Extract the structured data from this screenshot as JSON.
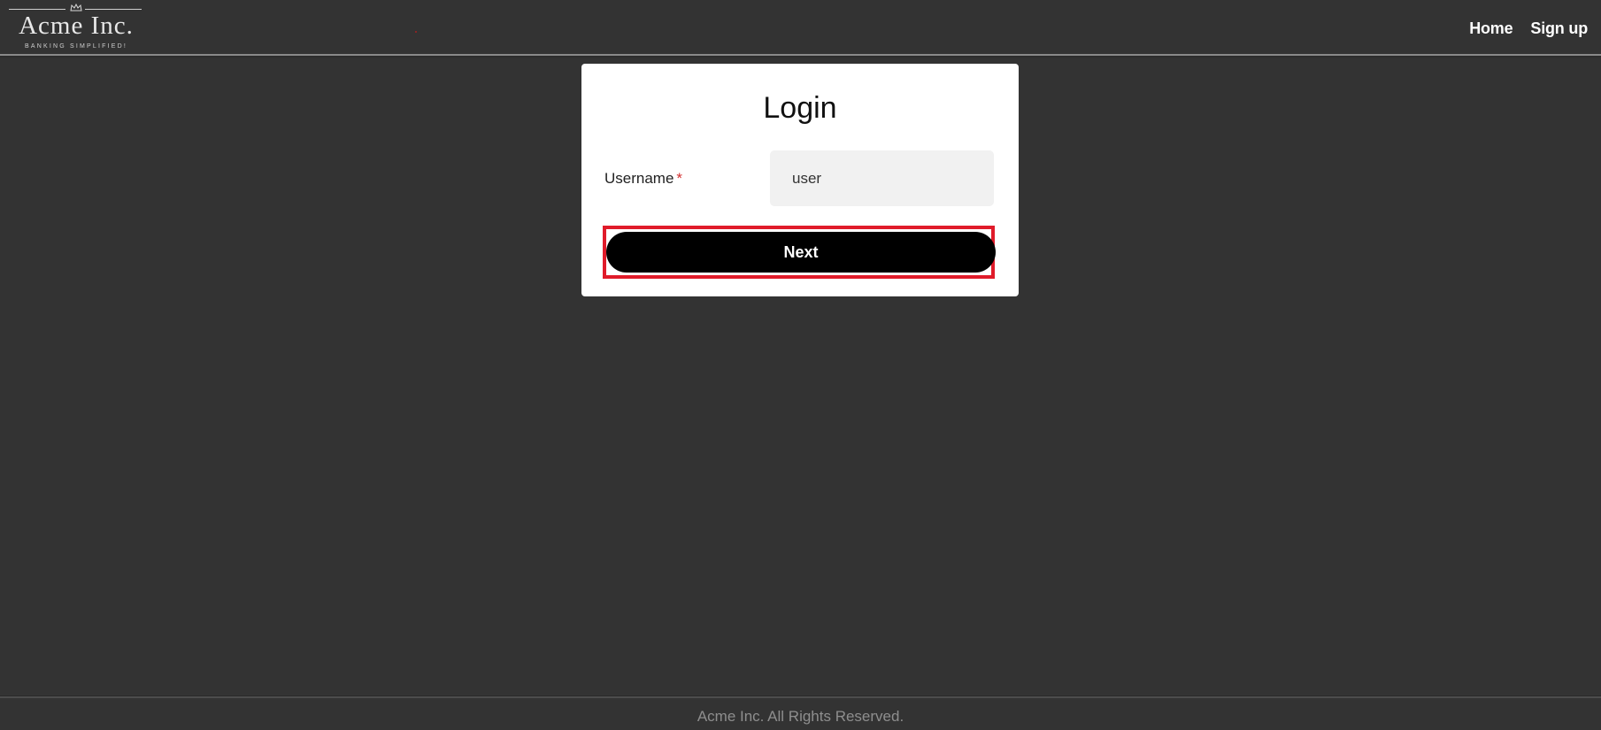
{
  "header": {
    "logo": {
      "title": "Acme Inc.",
      "tagline": "BANKING SIMPLIFIED!"
    },
    "nav": {
      "home_label": "Home",
      "signup_label": "Sign up"
    }
  },
  "login_card": {
    "title": "Login",
    "username_label": "Username",
    "required_marker": "*",
    "username_value": "user",
    "next_label": "Next"
  },
  "footer": {
    "text": "Acme Inc. All Rights Reserved."
  },
  "colors": {
    "background": "#333333",
    "card": "#ffffff",
    "button": "#000000",
    "required": "#d32f2f",
    "highlight": "#e01b2a",
    "input_bg": "#f1f1f1"
  },
  "icons": {
    "logo_crown": "crown-icon"
  }
}
